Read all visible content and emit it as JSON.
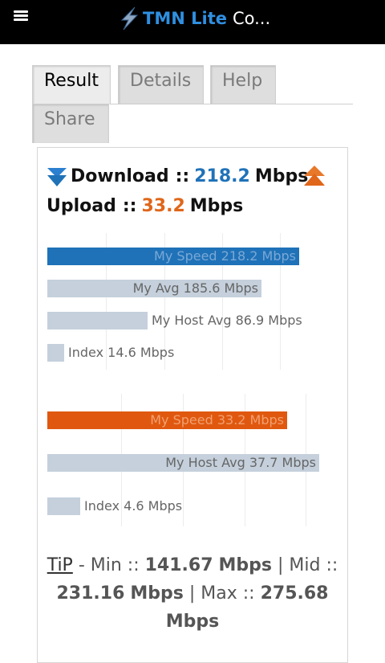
{
  "header": {
    "title_brand": "TMN Lite",
    "title_rest": "Co...",
    "menu_icon": "hamburger-icon",
    "logo_icon": "lightning-bolt-icon"
  },
  "tabs": [
    {
      "label": "Result",
      "active": true
    },
    {
      "label": "Details",
      "active": false
    },
    {
      "label": "Help",
      "active": false
    },
    {
      "label": "Share",
      "active": false
    }
  ],
  "summary": {
    "download_label": "Download",
    "download_sep": "::",
    "download_value": "218.2",
    "download_unit": "Mbps",
    "upload_label": "Upload",
    "upload_sep": "::",
    "upload_value": "33.2",
    "upload_unit": "Mbps",
    "download_color": "#1f72b8",
    "upload_color": "#e0661a"
  },
  "chart_data": [
    {
      "type": "bar",
      "orientation": "horizontal",
      "categories": [
        "My Speed",
        "My Avg",
        "My Host Avg",
        "Index"
      ],
      "values": [
        218.2,
        185.6,
        86.9,
        14.6
      ],
      "labels": [
        "My Speed 218.2 Mbps",
        "My Avg 185.6 Mbps",
        "My Host Avg 86.9 Mbps",
        "Index 14.6 Mbps"
      ],
      "colors": [
        "#1f72b8",
        "#c5d0dc",
        "#c5d0dc",
        "#c5d0dc"
      ],
      "unit": "Mbps",
      "xlim": [
        0,
        218.2
      ]
    },
    {
      "type": "bar",
      "orientation": "horizontal",
      "categories": [
        "My Speed",
        "My Host Avg",
        "Index"
      ],
      "values": [
        33.2,
        37.7,
        4.6
      ],
      "labels": [
        "My Speed 33.2 Mbps",
        "My Host Avg 37.7 Mbps",
        "Index 4.6 Mbps"
      ],
      "colors": [
        "#e0580f",
        "#c5d0dc",
        "#c5d0dc"
      ],
      "unit": "Mbps",
      "xlim": [
        0,
        37.7
      ]
    }
  ],
  "tip": {
    "link": "TiP",
    "min_label": "- Min ::",
    "min_value": "141.67",
    "unit": "Mbps",
    "mid_label": "| Mid ::",
    "mid_value": "231.16",
    "max_label": "| Max ::",
    "max_value": "275.68"
  }
}
